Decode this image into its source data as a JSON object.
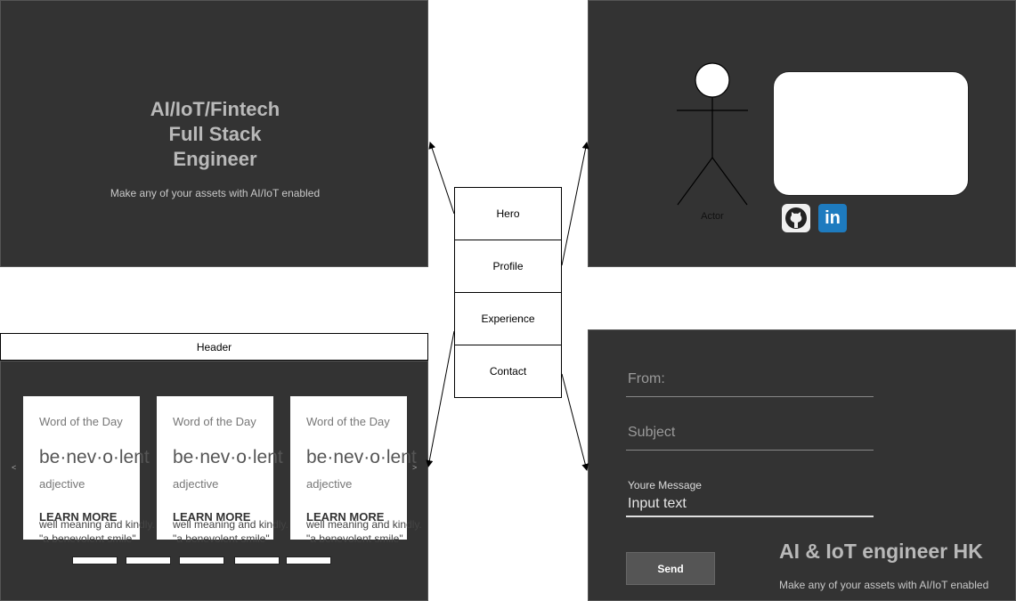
{
  "hero": {
    "title_lines": [
      "AI/IoT/Fintech",
      "Full Stack",
      "Engineer"
    ],
    "subtitle": "Make any  of your assets with AI/IoT enabled"
  },
  "nav": {
    "items": [
      {
        "label": "Hero"
      },
      {
        "label": "Profile"
      },
      {
        "label": "Experience"
      },
      {
        "label": "Contact"
      }
    ]
  },
  "profile": {
    "actor_label": "Actor",
    "icons": [
      "github-icon",
      "linkedin-icon"
    ],
    "linkedin_glyph": "in"
  },
  "experience": {
    "header": "Header",
    "prev_arrow": "<",
    "next_arrow": ">",
    "cards": [
      {
        "title": "Word of the Day",
        "word": "be·nev·o·lent",
        "word_overflow": "nt",
        "pos": "adjective",
        "more": "LEARN MORE",
        "def1": "well meaning and kindly.",
        "def2": "\"a benevolent smile\""
      },
      {
        "title": "Word of the Day",
        "word": "be·nev·o·lent",
        "word_overflow": "nt",
        "pos": "adjective",
        "more": "LEARN MORE",
        "def1": "well meaning and kindly.",
        "def2": "\"a benevolent smile\""
      },
      {
        "title": "Word of the Day",
        "word": "be·nev·o·lent",
        "word_overflow": "nt",
        "pos": "adjective",
        "more": "LEARN MORE",
        "def1": "well meaning and kindly.",
        "def2": "\"a benevolent smile\""
      }
    ],
    "dot_count": 5
  },
  "contact": {
    "from_placeholder": "From:",
    "subject_placeholder": "Subject",
    "message_label": "Youre Message",
    "message_value": "Input text",
    "send_label": "Send",
    "title": "AI & IoT engineer HK",
    "subtitle": "Make any  of your assets with AI/IoT enabled"
  },
  "colors": {
    "panel_bg": "#333333",
    "hero_text": "#b9b9b9",
    "linkedin": "#1e7bbf"
  }
}
